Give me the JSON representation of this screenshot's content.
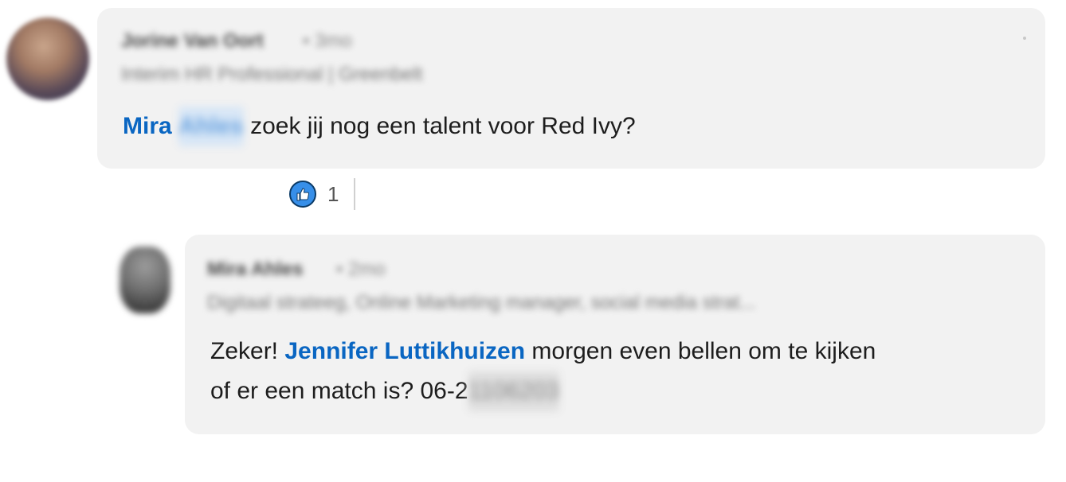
{
  "comment": {
    "author_name": "Jorine Van Oort",
    "time": "• 3mo",
    "headline": "Interim HR Professional | Greenbelt",
    "mention_first": "Mira",
    "mention_last": "Ahles",
    "text": "zoek jij nog een talent voor Red Ivy?",
    "reactions": {
      "icon": "thumbs-up-icon",
      "count": "1"
    }
  },
  "reply": {
    "author_name": "Mira Ahles",
    "time": "• 2mo",
    "headline": "Digitaal strateeg, Online Marketing manager, social media strat...",
    "text_before": "Zeker!",
    "mention": "Jennifer Luttikhuizen",
    "text_after_line1": "morgen even bellen om te kijken",
    "text_line2_prefix": "of er een match is? 06-2",
    "text_line2_hidden": "1106203"
  },
  "colors": {
    "mention": "#0a66c2",
    "bubble": "#f2f2f2",
    "like": "#378fe9"
  }
}
